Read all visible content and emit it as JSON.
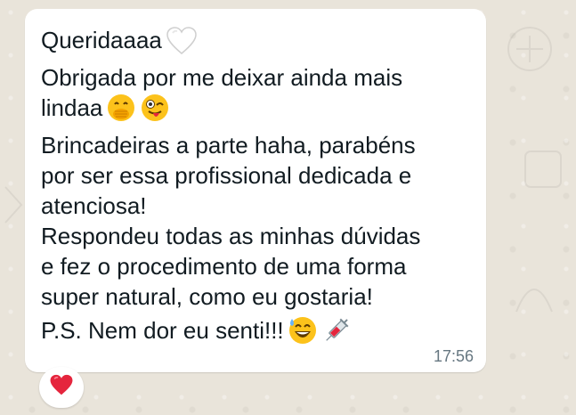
{
  "message": {
    "lines": [
      "Queridaaaa",
      "Obrigada por me deixar ainda mais",
      "lindaa",
      "Brincadeiras a parte haha, parabéns",
      "por ser essa profissional dedicada e",
      "atenciosa!",
      "Respondeu todas as minhas dúvidas",
      "e fez o procedimento de uma forma",
      "super natural, como eu gostaria!",
      "P.S. Nem dor eu senti!!!"
    ],
    "timestamp": "17:56",
    "emojis": {
      "line1": [
        "white-heart-icon"
      ],
      "line3": [
        "face-with-hand-over-mouth-icon",
        "winking-face-with-tongue-icon"
      ],
      "line10": [
        "grinning-face-with-sweat-icon",
        "syringe-icon"
      ]
    }
  },
  "reaction": {
    "icon": "red-heart-icon"
  },
  "colors": {
    "background": "#e9e4da",
    "bubble": "#ffffff",
    "text": "#111b21",
    "timestamp": "#667781",
    "reaction_heart": "#e5253d"
  }
}
